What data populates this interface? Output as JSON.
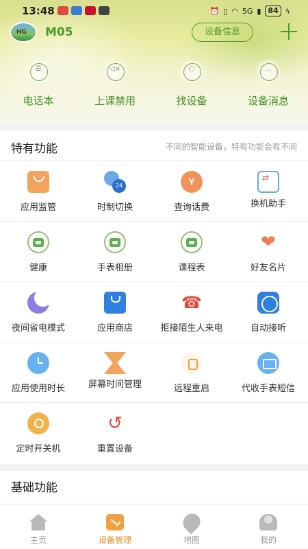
{
  "status_bar": {
    "time": "13:48",
    "network": "5G",
    "battery": "84"
  },
  "header": {
    "device_name": "M05",
    "info_button": "设备信息",
    "add_icon": "plus-icon"
  },
  "quick_actions": [
    {
      "label": "电话本",
      "icon": "phonebook-icon"
    },
    {
      "label": "上课禁用",
      "icon": "mute-icon"
    },
    {
      "label": "找设备",
      "icon": "find-device-icon"
    },
    {
      "label": "设备消息",
      "icon": "message-icon"
    }
  ],
  "special": {
    "title": "特有功能",
    "tip": "不同的智能设备，特有功能会有不同",
    "items": [
      {
        "label": "应用监管",
        "icon": "app-monitor-icon"
      },
      {
        "label": "时制切换",
        "icon": "time-format-icon"
      },
      {
        "label": "查询话费",
        "icon": "phone-bill-icon"
      },
      {
        "label": "换机助手",
        "icon": "device-switch-icon"
      },
      {
        "label": "健康",
        "icon": "health-icon"
      },
      {
        "label": "手表相册",
        "icon": "watch-album-icon"
      },
      {
        "label": "课程表",
        "icon": "timetable-icon"
      },
      {
        "label": "好友名片",
        "icon": "friend-card-icon"
      },
      {
        "label": "夜间省电模式",
        "icon": "night-mode-icon"
      },
      {
        "label": "应用商店",
        "icon": "app-store-icon"
      },
      {
        "label": "拒接陌生人来电",
        "icon": "reject-call-icon"
      },
      {
        "label": "自动接听",
        "icon": "auto-answer-icon"
      },
      {
        "label": "应用使用时长",
        "icon": "app-usage-icon"
      },
      {
        "label": "屏幕时间管理",
        "icon": "screen-time-icon"
      },
      {
        "label": "远程重启",
        "icon": "remote-reboot-icon"
      },
      {
        "label": "代收手表短信",
        "icon": "sms-icon"
      },
      {
        "label": "定时开关机",
        "icon": "power-schedule-icon"
      },
      {
        "label": "重置设备",
        "icon": "reset-icon"
      }
    ]
  },
  "basic": {
    "title": "基础功能"
  },
  "bottom_nav": [
    {
      "label": "主页",
      "icon": "home-icon",
      "active": false
    },
    {
      "label": "设备管理",
      "icon": "device-manage-icon",
      "active": true
    },
    {
      "label": "地图",
      "icon": "map-icon",
      "active": false
    },
    {
      "label": "我的",
      "icon": "profile-icon",
      "active": false
    }
  ],
  "colors": {
    "accent_green": "#4f9a2a",
    "active_tab": "#e58a20"
  }
}
